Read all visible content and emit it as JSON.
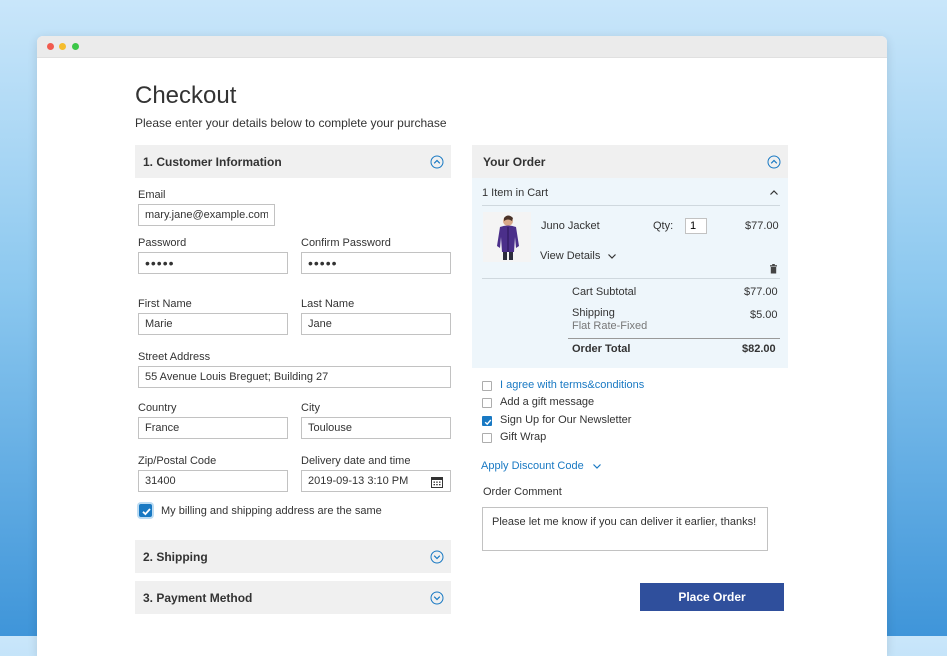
{
  "page": {
    "title": "Checkout",
    "subtitle": "Please enter your details below to complete your purchase"
  },
  "sections": {
    "customer": "1. Customer Information",
    "shipping": "2. Shipping",
    "payment": "3. Payment Method"
  },
  "form": {
    "email_label": "Email",
    "email_value": "mary.jane@example.com",
    "password_label": "Password",
    "password_value": "•••••",
    "confirm_password_label": "Confirm Password",
    "confirm_password_value": "•••••",
    "first_name_label": "First Name",
    "first_name_value": "Marie",
    "last_name_label": "Last Name",
    "last_name_value": "Jane",
    "street_label": "Street Address",
    "street_value": "55 Avenue Louis Breguet; Building 27",
    "country_label": "Country",
    "country_value": "France",
    "city_label": "City",
    "city_value": "Toulouse",
    "zip_label": "Zip/Postal Code",
    "zip_value": "31400",
    "delivery_label": "Delivery date and time",
    "delivery_value": "2019-09-13 3:10 PM",
    "same_address_label": "My billing and shipping address are the same",
    "same_address_checked": true
  },
  "order": {
    "title": "Your Order",
    "items_in_cart": "1 Item in Cart",
    "product_name": "Juno Jacket",
    "qty_label": "Qty:",
    "qty_value": "1",
    "product_price": "$77.00",
    "view_details": "View Details",
    "subtotal_label": "Cart Subtotal",
    "subtotal_value": "$77.00",
    "shipping_label": "Shipping",
    "shipping_method": "Flat Rate-Fixed",
    "shipping_value": "$5.00",
    "total_label": "Order Total",
    "total_value": "$82.00"
  },
  "options": {
    "terms": "I agree with terms&conditions",
    "gift_message": "Add a gift message",
    "newsletter": "Sign Up for Our Newsletter",
    "newsletter_checked": true,
    "gift_wrap": "Gift Wrap",
    "discount_link": "Apply Discount Code",
    "comment_label": "Order Comment",
    "comment_value": "Please let me know if you can deliver it earlier, thanks!"
  },
  "actions": {
    "place_order": "Place Order"
  },
  "colors": {
    "accent": "#1979c3",
    "button": "#2f4f9c",
    "panel": "#eef6fb",
    "section_bar": "#f0f0f0"
  },
  "icons": {
    "collapse": "chevron-up-circle-icon",
    "expand": "chevron-down-circle-icon",
    "calendar": "calendar-icon",
    "trash": "trash-icon"
  }
}
